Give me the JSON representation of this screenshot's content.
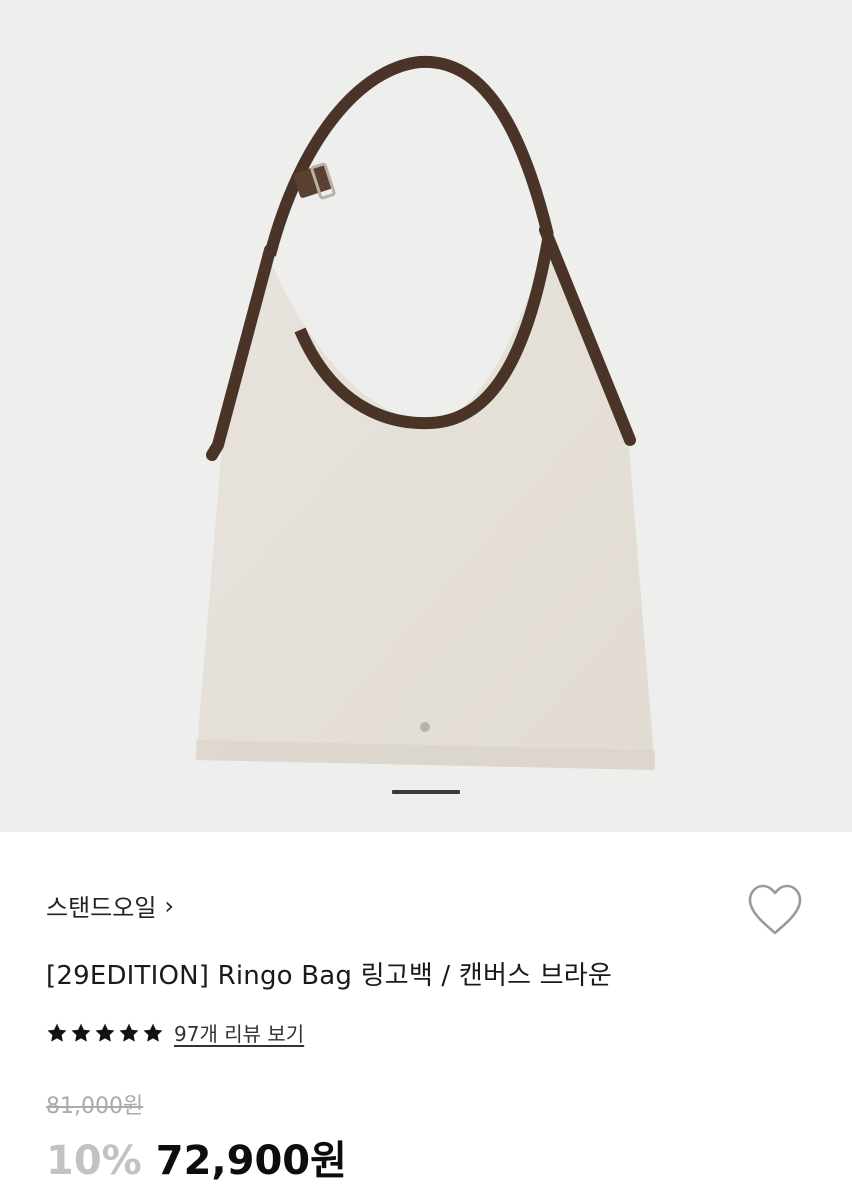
{
  "product": {
    "brand": "스탠드오일",
    "brand_chevron": "›",
    "title": "[29EDITION]  Ringo Bag  링고백 / 캔버스 브라운",
    "rating_stars": 5,
    "reviews_link": "97개 리뷰 보기",
    "original_price": "81,000원",
    "discount": "10%",
    "sale_price": "72,900원"
  },
  "gallery": {
    "current_index": 1
  },
  "icons": {
    "wishlist": "heart-outline-icon",
    "star": "star-filled-icon",
    "chevron": "chevron-right-icon"
  },
  "colors": {
    "hero_bg": "#eeeeec",
    "bag_body": "#e6e1da",
    "strap": "#4a3428"
  }
}
